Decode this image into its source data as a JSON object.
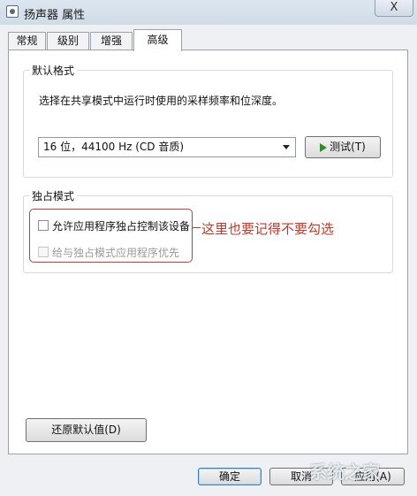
{
  "window": {
    "title": "扬声器 属性",
    "close_glyph": "X"
  },
  "tabs": [
    {
      "label": "常规",
      "active": false
    },
    {
      "label": "级别",
      "active": false
    },
    {
      "label": "增强",
      "active": false
    },
    {
      "label": "高级",
      "active": true
    }
  ],
  "default_format": {
    "group_label": "默认格式",
    "description": "选择在共享模式中运行时使用的采样频率和位深度。",
    "selected_format": "16 位，44100 Hz (CD 音质)",
    "test_button_label": "测试(T)"
  },
  "exclusive_mode": {
    "group_label": "独占模式",
    "allow_exclusive_label": "允许应用程序独占控制该设备",
    "allow_exclusive_checked": false,
    "priority_label": "给与独占模式应用程序优先",
    "priority_checked": false,
    "priority_enabled": false
  },
  "annotation": {
    "text": "这里也要记得不要勾选",
    "color": "#c0392b"
  },
  "restore_defaults_label": "还原默认值(D)",
  "footer": {
    "ok_label": "确定",
    "cancel_label": "取消",
    "apply_label": "应用(A)"
  },
  "watermark": {
    "text": "系统之家"
  }
}
